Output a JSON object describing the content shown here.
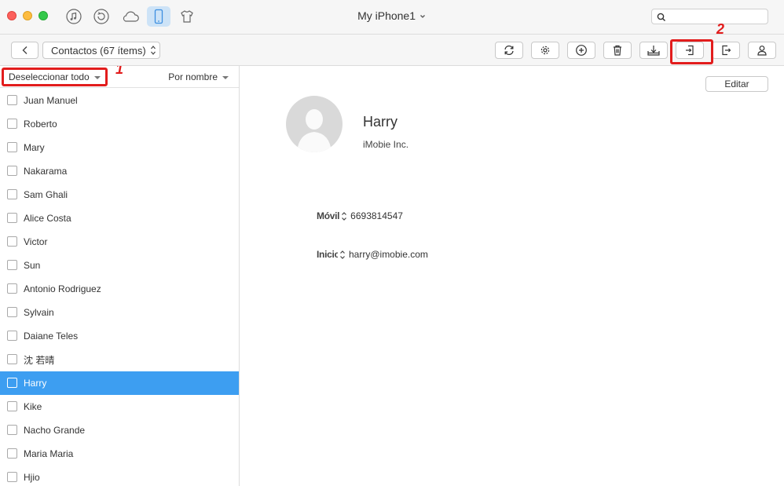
{
  "window": {
    "device_title": "My iPhone1",
    "nav_icons": [
      "music-note-icon",
      "history-icon",
      "cloud-icon",
      "phone-icon",
      "tshirt-icon"
    ],
    "search": {
      "placeholder": "",
      "value": ""
    }
  },
  "toolbar": {
    "category": "Contactos (67 ítems)",
    "actions": [
      "refresh-icon",
      "settings-icon",
      "add-icon",
      "trash-icon",
      "to-computer-icon",
      "import-icon",
      "export-icon",
      "contact-icon"
    ]
  },
  "annotations": {
    "marker1": "1",
    "marker2": "2",
    "highlight_color": "#e21d1d"
  },
  "sidebar": {
    "deselect_label": "Deseleccionar todo",
    "sort_label": "Por nombre",
    "contacts": [
      "Juan Manuel",
      "Roberto",
      "Mary",
      "Nakarama",
      "Sam Ghali",
      "Alice Costa",
      "Victor",
      "Sun",
      "Antonio Rodriguez",
      "Sylvain",
      "Daiane Teles",
      "沈 若晴",
      "Harry",
      "Kike",
      "Nacho Grande",
      "Maria Maria",
      "Hjio"
    ],
    "selected_contact": "Harry",
    "selected_color": "#3d9ef1"
  },
  "detail": {
    "edit_label": "Editar",
    "name": "Harry",
    "company": "iMobie Inc.",
    "fields": [
      {
        "label": "Móvil",
        "value": "6693814547"
      },
      {
        "label": "Inicio",
        "value": "harry@imobie.com"
      }
    ]
  }
}
